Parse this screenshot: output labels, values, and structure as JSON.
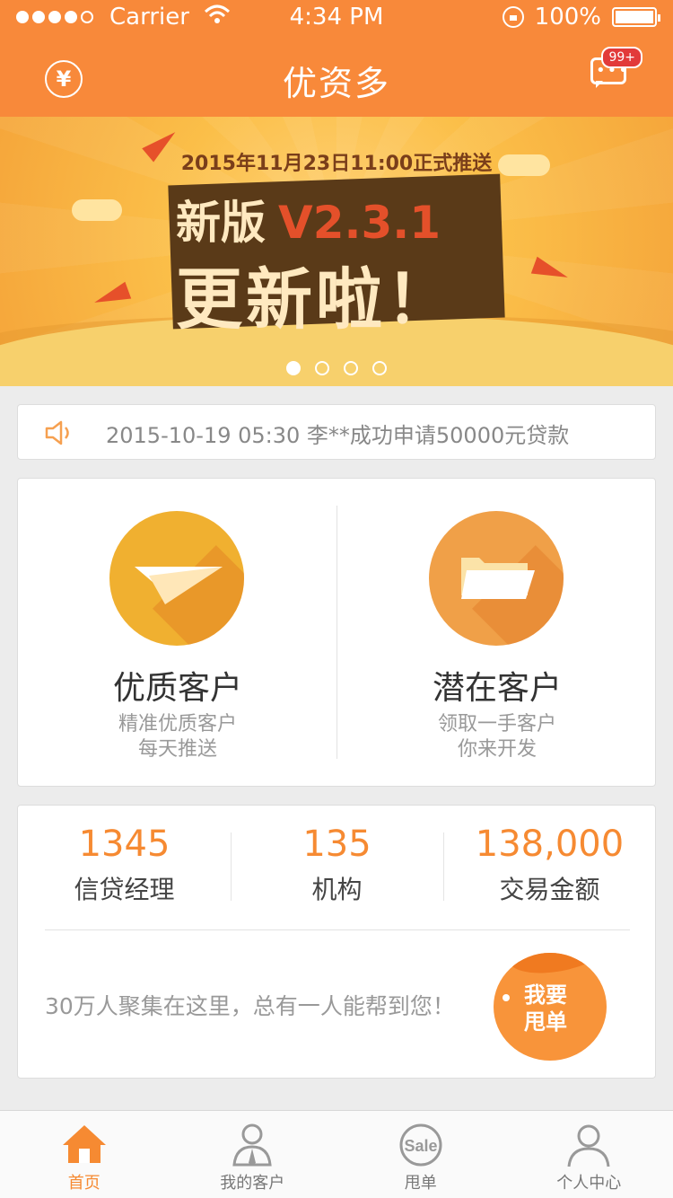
{
  "status_bar": {
    "carrier": "Carrier",
    "time": "4:34 PM",
    "battery": "100%"
  },
  "header": {
    "title": "优资多",
    "yen_symbol": "¥",
    "message_badge": "99+"
  },
  "banner": {
    "date_line": "2015年11月23日11:00正式推送",
    "headline_prefix": "新版",
    "version": "V2.3.1",
    "headline_main": "更新啦！",
    "page_count": 4,
    "active_page": 0
  },
  "notice": {
    "text": "2015-10-19 05:30  李**成功申请50000元贷款"
  },
  "customers": {
    "left": {
      "title": "优质客户",
      "sub_line1": "精准优质客户",
      "sub_line2": "每天推送"
    },
    "right": {
      "title": "潜在客户",
      "sub_line1": "领取一手客户",
      "sub_line2": "你来开发"
    }
  },
  "stats": {
    "items": [
      {
        "value": "1345",
        "label": "信贷经理"
      },
      {
        "value": "135",
        "label": "机构"
      },
      {
        "value": "138,000",
        "label": "交易金额"
      }
    ],
    "slogan": "30万人聚集在这里，总有一人能帮到您！",
    "button_line1": "我要",
    "button_line2": "甩单"
  },
  "tabbar": {
    "items": [
      {
        "label": "首页",
        "icon": "home-icon"
      },
      {
        "label": "我的客户",
        "icon": "customers-icon"
      },
      {
        "label": "甩单",
        "icon": "sale-icon"
      },
      {
        "label": "个人中心",
        "icon": "profile-icon"
      }
    ]
  },
  "colors": {
    "brand_orange": "#f8893a",
    "accent_orange": "#f68a32",
    "badge_red": "#e23a3a",
    "yellow_circle": "#f0b030"
  }
}
